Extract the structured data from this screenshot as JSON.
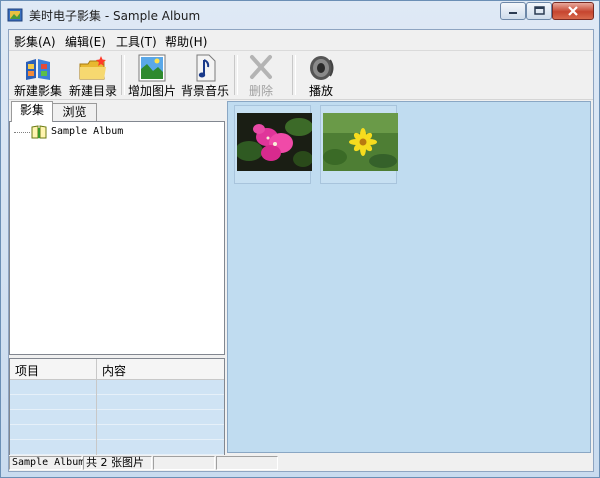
{
  "window": {
    "title": "美时电子影集 - Sample Album"
  },
  "menu": [
    {
      "label": "影集(A)"
    },
    {
      "label": "编辑(E)"
    },
    {
      "label": "工具(T)"
    },
    {
      "label": "帮助(H)"
    }
  ],
  "toolbar": {
    "new_album": "新建影集",
    "new_folder": "新建目录",
    "add_picture": "增加图片",
    "bg_music": "背景音乐",
    "delete": "删除",
    "play": "播放"
  },
  "tabs": {
    "album": "影集",
    "browse": "浏览"
  },
  "tree": {
    "root_label": "Sample Album"
  },
  "properties": {
    "col_item": "项目",
    "col_content": "内容"
  },
  "thumbnails": [
    {
      "icon": "pink-bougainvillea-photo"
    },
    {
      "icon": "yellow-daisy-photo"
    }
  ],
  "statusbar": {
    "album_name": "Sample Album",
    "picture_count": "共 2 张图片"
  },
  "colors": {
    "thumb_bg": "#c0dcf0",
    "prop_row": "#cfe3f4",
    "close_red": "#c6452f"
  }
}
